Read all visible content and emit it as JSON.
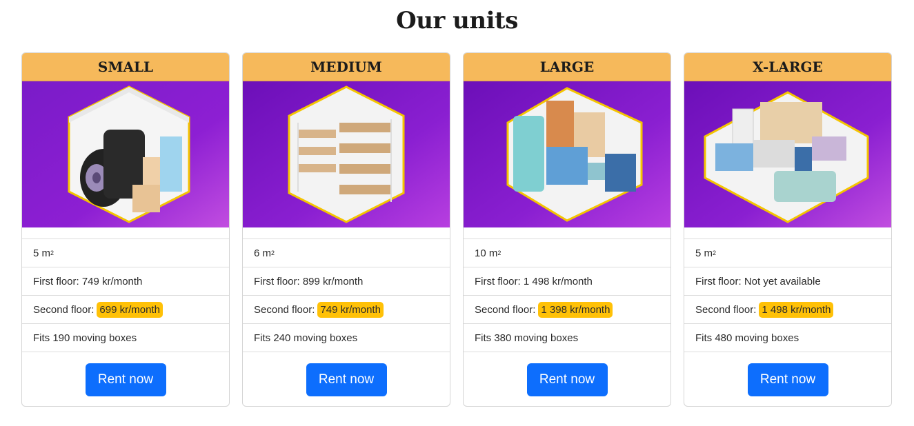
{
  "page": {
    "title": "Our units"
  },
  "colors": {
    "header_bg": "#f6b95b",
    "price_highlight": "#ffc107",
    "button": "#0d6efd",
    "image_bg": "#8a1fd1"
  },
  "units": [
    {
      "name": "SMALL",
      "size": "5 m",
      "size_unit": "2",
      "first_floor_label": "First floor: 749 kr/month",
      "second_floor_label": "Second floor:",
      "second_floor_price": "699 kr/month",
      "fits": "Fits 190 moving boxes",
      "button": "Rent now",
      "image_icon": "tires-storage-image"
    },
    {
      "name": "MEDIUM",
      "size": "6 m",
      "size_unit": "2",
      "first_floor_label": "First floor: 899 kr/month",
      "second_floor_label": "Second floor:",
      "second_floor_price": "749 kr/month",
      "fits": "Fits 240 moving boxes",
      "button": "Rent now",
      "image_icon": "shelves-boxes-image"
    },
    {
      "name": "LARGE",
      "size": "10 m",
      "size_unit": "2",
      "first_floor_label": "First floor: 1 498 kr/month",
      "second_floor_label": "Second floor:",
      "second_floor_price": "1 398 kr/month",
      "fits": "Fits 380 moving boxes",
      "button": "Rent now",
      "image_icon": "furniture-storage-image"
    },
    {
      "name": "X-LARGE",
      "size": "5 m",
      "size_unit": "2",
      "first_floor_label": "First floor: Not yet available",
      "second_floor_label": "Second floor:",
      "second_floor_price": "1 498 kr/month",
      "fits": "Fits 480 moving boxes",
      "button": "Rent now",
      "image_icon": "room-furniture-image"
    }
  ]
}
